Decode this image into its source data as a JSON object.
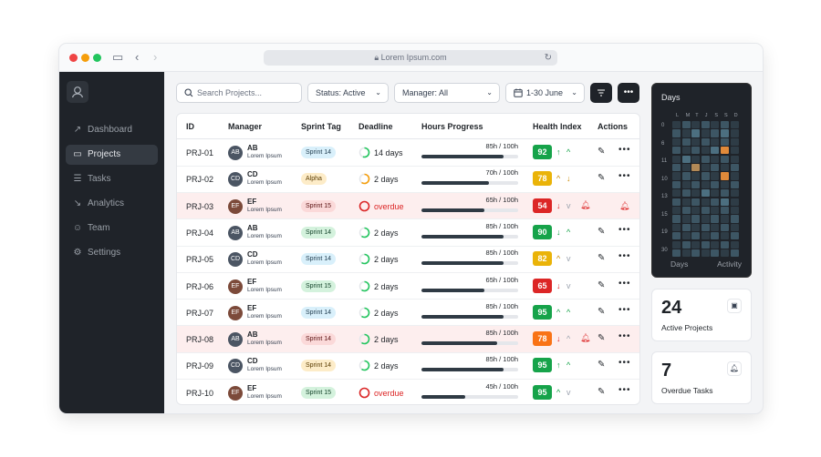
{
  "browser": {
    "url": "Lorem Ipsum.com"
  },
  "sidebar": {
    "items": [
      {
        "label": "Dashboard",
        "icon": "chart-icon",
        "active": false
      },
      {
        "label": "Projects",
        "icon": "folder-icon",
        "active": true
      },
      {
        "label": "Tasks",
        "icon": "list-icon",
        "active": false
      },
      {
        "label": "Analytics",
        "icon": "analytics-icon",
        "active": false
      },
      {
        "label": "Team",
        "icon": "team-icon",
        "active": false
      },
      {
        "label": "Settings",
        "icon": "gear-icon",
        "active": false
      }
    ]
  },
  "toolbar": {
    "search_placeholder": "Search Projects...",
    "status_label": "Status:",
    "status_value": "Active",
    "manager_label": "Manager:",
    "manager_value": "All",
    "date_range": "1-30 June"
  },
  "table": {
    "headers": {
      "id": "ID",
      "manager": "Manager",
      "sprint": "Sprint Tag",
      "deadline": "Deadline",
      "hours": "Hours Progress",
      "health": "Health Index",
      "actions": "Actions"
    },
    "rows": [
      {
        "id": "PRJ-01",
        "initials": "AB",
        "sub": "Lorem Ipsum",
        "avatar_color": "#4b5563",
        "sprint": "Sprint 14",
        "sprint_bg": "#d9f0fb",
        "sprint_fg": "#1e3a4c",
        "deadline": "14 days",
        "deadline_progress": 0.55,
        "ring_color": "#22c55e",
        "hours": "85h / 100h",
        "progress": 0.85,
        "health": "92",
        "health_color": "#16a34a",
        "arrow1": "↑",
        "arrow1_color": "#16a34a",
        "arrow2": "^",
        "arrow2_color": "#16a34a",
        "alert": false
      },
      {
        "id": "PRJ-02",
        "initials": "CD",
        "sub": "Lorem Ipsum",
        "avatar_color": "#4b5563",
        "sprint": "Alpha",
        "sprint_bg": "#fdecc8",
        "sprint_fg": "#5a3b00",
        "deadline": "2 days",
        "deadline_progress": 0.6,
        "ring_color": "#f59e0b",
        "hours": "70h / 100h",
        "progress": 0.7,
        "health": "78",
        "health_color": "#eab308",
        "arrow1": "^",
        "arrow1_color": "#ca8a04",
        "arrow2": "↓",
        "arrow2_color": "#ca8a04",
        "alert": false
      },
      {
        "id": "PRJ-03",
        "initials": "EF",
        "sub": "Lorem Ipsum",
        "avatar_color": "#7c4a3a",
        "sprint": "Sprint 15",
        "sprint_bg": "#fbd9d9",
        "sprint_fg": "#5a1010",
        "deadline": "overdue",
        "deadline_progress": 1,
        "ring_color": "#dc2626",
        "hours": "65h / 100h",
        "progress": 0.65,
        "health": "54",
        "health_color": "#dc2626",
        "arrow1": "↓",
        "arrow1_color": "#dc2626",
        "arrow2": "v",
        "arrow2_color": "#9ca3af",
        "alert": true
      },
      {
        "id": "PRJ-04",
        "initials": "AB",
        "sub": "Lorem Ipsum",
        "avatar_color": "#4b5563",
        "sprint": "Sprint 14",
        "sprint_bg": "#d4f2dd",
        "sprint_fg": "#14432a",
        "deadline": "2 days",
        "deadline_progress": 0.6,
        "ring_color": "#22c55e",
        "hours": "85h / 100h",
        "progress": 0.85,
        "health": "90",
        "health_color": "#16a34a",
        "arrow1": "↓",
        "arrow1_color": "#16a34a",
        "arrow2": "^",
        "arrow2_color": "#16a34a",
        "alert": false
      },
      {
        "id": "PRJ-05",
        "initials": "CD",
        "sub": "Lorem Ipsum",
        "avatar_color": "#4b5563",
        "sprint": "Sprint 14",
        "sprint_bg": "#d9f0fb",
        "sprint_fg": "#1e3a4c",
        "deadline": "2 days",
        "deadline_progress": 0.6,
        "ring_color": "#22c55e",
        "hours": "85h / 100h",
        "progress": 0.85,
        "health": "82",
        "health_color": "#eab308",
        "arrow1": "^",
        "arrow1_color": "#ca8a04",
        "arrow2": "v",
        "arrow2_color": "#9ca3af",
        "alert": false
      },
      {
        "id": "PRJ-06",
        "initials": "EF",
        "sub": "Lorem Ipsum",
        "avatar_color": "#7c4a3a",
        "sprint": "Sprint 15",
        "sprint_bg": "#d4f2dd",
        "sprint_fg": "#14432a",
        "deadline": "2 days",
        "deadline_progress": 0.6,
        "ring_color": "#22c55e",
        "hours": "65h / 100h",
        "progress": 0.65,
        "health": "65",
        "health_color": "#dc2626",
        "arrow1": "↓",
        "arrow1_color": "#dc2626",
        "arrow2": "v",
        "arrow2_color": "#9ca3af",
        "alert": false
      },
      {
        "id": "PRJ-07",
        "initials": "EF",
        "sub": "Lorem Ipsum",
        "avatar_color": "#7c4a3a",
        "sprint": "Sprint 14",
        "sprint_bg": "#d9f0fb",
        "sprint_fg": "#1e3a4c",
        "deadline": "2 days",
        "deadline_progress": 0.6,
        "ring_color": "#22c55e",
        "hours": "85h / 100h",
        "progress": 0.85,
        "health": "95",
        "health_color": "#16a34a",
        "arrow1": "^",
        "arrow1_color": "#16a34a",
        "arrow2": "^",
        "arrow2_color": "#16a34a",
        "alert": false
      },
      {
        "id": "PRJ-08",
        "initials": "AB",
        "sub": "Lorem Ipsum",
        "avatar_color": "#4b5563",
        "sprint": "Sprint 14",
        "sprint_bg": "#fbd9d9",
        "sprint_fg": "#5a1010",
        "deadline": "2 days",
        "deadline_progress": 0.6,
        "ring_color": "#22c55e",
        "hours": "85h / 100h",
        "progress": 0.78,
        "health": "78",
        "health_color": "#f97316",
        "arrow1": "↓",
        "arrow1_color": "#dc2626",
        "arrow2": "^",
        "arrow2_color": "#9ca3af",
        "alert": true
      },
      {
        "id": "PRJ-09",
        "initials": "CD",
        "sub": "Lorem Ipsum",
        "avatar_color": "#4b5563",
        "sprint": "Sprint 14",
        "sprint_bg": "#fdecc8",
        "sprint_fg": "#5a3b00",
        "deadline": "2 days",
        "deadline_progress": 0.6,
        "ring_color": "#22c55e",
        "hours": "85h / 100h",
        "progress": 0.85,
        "health": "95",
        "health_color": "#16a34a",
        "arrow1": "↑",
        "arrow1_color": "#16a34a",
        "arrow2": "^",
        "arrow2_color": "#16a34a",
        "alert": false
      },
      {
        "id": "PRJ-10",
        "initials": "EF",
        "sub": "Lorem Ipsum",
        "avatar_color": "#7c4a3a",
        "sprint": "Sprint 15",
        "sprint_bg": "#d4f2dd",
        "sprint_fg": "#14432a",
        "deadline": "overdue",
        "deadline_progress": 1,
        "ring_color": "#dc2626",
        "hours": "45h / 100h",
        "progress": 0.45,
        "health": "95",
        "health_color": "#16a34a",
        "arrow1": "^",
        "arrow1_color": "#16a34a",
        "arrow2": "v",
        "arrow2_color": "#9ca3af",
        "alert": false
      }
    ]
  },
  "heatmap": {
    "title": "Days",
    "footer_left": "Days",
    "footer_right": "Activity",
    "weekdays": [
      "L",
      "M",
      "T",
      "J",
      "S",
      "S",
      "D"
    ],
    "y_labels": [
      "0",
      "6",
      "11",
      "10",
      "13",
      "15",
      "19",
      "30"
    ],
    "colors": {
      "low": "#2e3c46",
      "mid": "#3d5664",
      "high": "#4c6f80",
      "warm": "#b38a57",
      "hot": "#e08a3a"
    },
    "grid": [
      [
        "low",
        "mid",
        "low",
        "mid",
        "low",
        "mid",
        "low"
      ],
      [
        "mid",
        "low",
        "high",
        "low",
        "mid",
        "high",
        "low"
      ],
      [
        "low",
        "mid",
        "low",
        "mid",
        "low",
        "mid",
        "low"
      ],
      [
        "mid",
        "low",
        "mid",
        "low",
        "high",
        "hot",
        "low"
      ],
      [
        "low",
        "high",
        "low",
        "mid",
        "low",
        "mid",
        "low"
      ],
      [
        "mid",
        "low",
        "warm",
        "low",
        "mid",
        "low",
        "mid"
      ],
      [
        "low",
        "mid",
        "low",
        "mid",
        "low",
        "hot",
        "low"
      ],
      [
        "mid",
        "low",
        "mid",
        "low",
        "mid",
        "low",
        "mid"
      ],
      [
        "low",
        "mid",
        "low",
        "high",
        "low",
        "mid",
        "low"
      ],
      [
        "mid",
        "low",
        "mid",
        "low",
        "mid",
        "high",
        "low"
      ],
      [
        "low",
        "mid",
        "low",
        "mid",
        "low",
        "mid",
        "low"
      ],
      [
        "mid",
        "low",
        "mid",
        "low",
        "mid",
        "low",
        "mid"
      ],
      [
        "low",
        "mid",
        "low",
        "mid",
        "low",
        "mid",
        "low"
      ],
      [
        "mid",
        "low",
        "mid",
        "low",
        "mid",
        "low",
        "mid"
      ],
      [
        "low",
        "mid",
        "low",
        "mid",
        "low",
        "mid",
        "low"
      ],
      [
        "mid",
        "low",
        "mid",
        "low",
        "mid",
        "low",
        "mid"
      ]
    ]
  },
  "stats": [
    {
      "value": "24",
      "label": "Active Projects",
      "icon": "projects-icon"
    },
    {
      "value": "7",
      "label": "Overdue Tasks",
      "icon": "bell-icon"
    }
  ]
}
